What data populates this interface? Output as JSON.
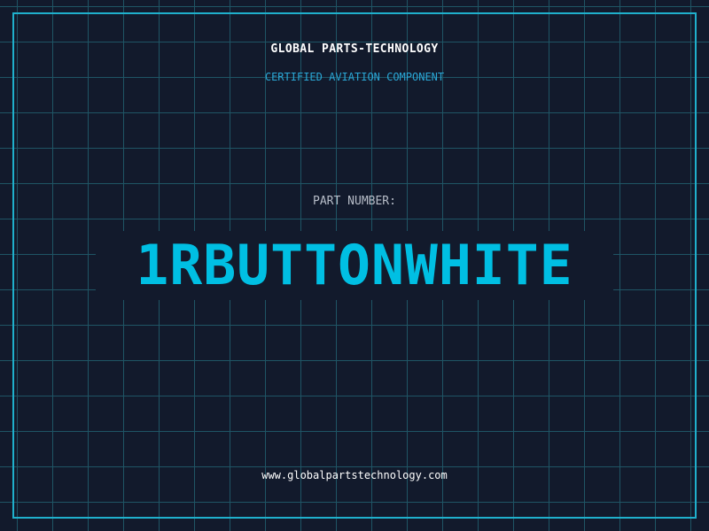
{
  "header": {
    "company": "GLOBAL PARTS-TECHNOLOGY",
    "tagline": "CERTIFIED AVIATION COMPONENT"
  },
  "part": {
    "label": "PART NUMBER:",
    "number": "1RBUTTONWHITE"
  },
  "footer": {
    "url": "www.globalpartstechnology.com"
  },
  "colors": {
    "background": "#121a2c",
    "grid": "#1f5565",
    "accent": "#00bfe3",
    "frame": "#1fb0cc"
  }
}
